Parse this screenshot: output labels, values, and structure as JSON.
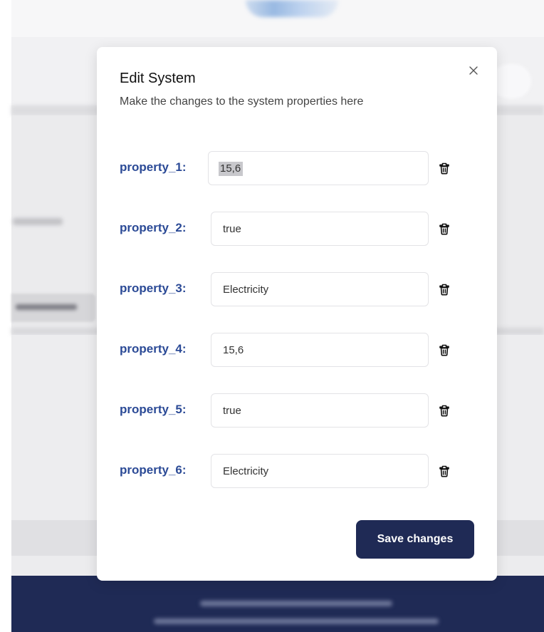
{
  "modal": {
    "title": "Edit System",
    "subtitle": "Make the changes to the system properties here",
    "close_icon": "close-icon",
    "save_label": "Save changes"
  },
  "properties": [
    {
      "label": "property_1:",
      "value": "15,6",
      "text_selected": true
    },
    {
      "label": "property_2:",
      "value": "true"
    },
    {
      "label": "property_3:",
      "value": "Electricity"
    },
    {
      "label": "property_4:",
      "value": "15,6"
    },
    {
      "label": "property_5:",
      "value": "true"
    },
    {
      "label": "property_6:",
      "value": "Electricity"
    }
  ],
  "colors": {
    "label": "#2b4a96",
    "primary_button": "#1f2a55",
    "footer": "#1f2a55"
  }
}
